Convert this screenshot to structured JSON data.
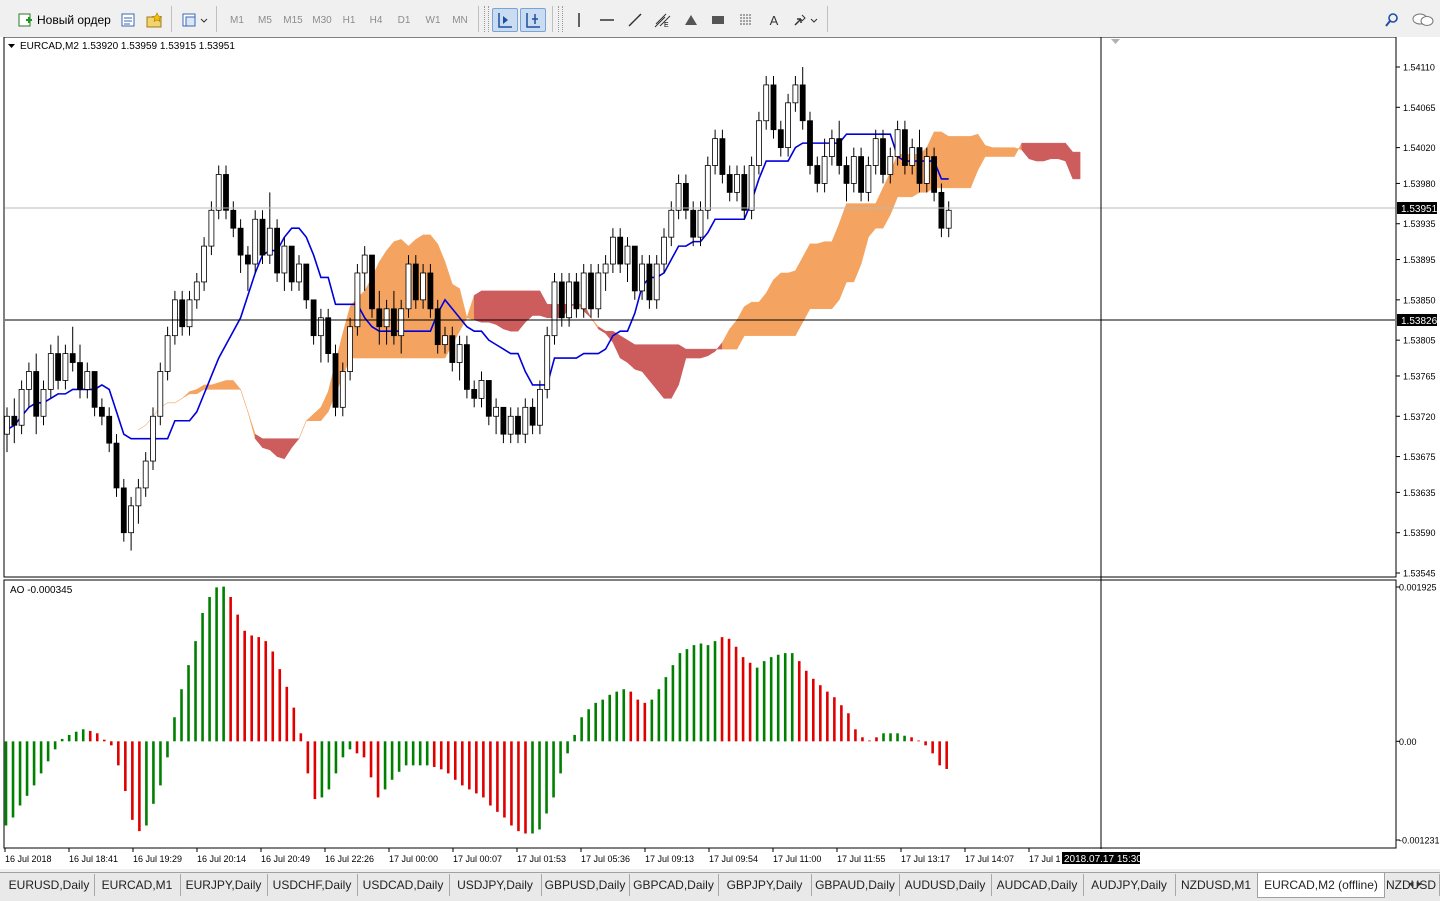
{
  "toolbar": {
    "new_order_label": "Новый ордер",
    "timeframes": [
      "M1",
      "M5",
      "M15",
      "M30",
      "H1",
      "H4",
      "D1",
      "W1",
      "MN"
    ],
    "tools": [
      "cursor-icon",
      "crosshair-icon",
      "vertical-line-icon",
      "horizontal-line-icon",
      "trendline-icon",
      "fibonacci-icon",
      "triangle-icon",
      "rectangle-icon",
      "grid-icon",
      "text-icon",
      "arrows-icon"
    ],
    "right_icons": [
      "search-icon",
      "chat-icon"
    ]
  },
  "chart_data": {
    "type": "candlestick",
    "symbol_label": "EURCAD,M2",
    "ohlc_label": "1.53920 1.53959 1.53915 1.53951",
    "price_ticks": [
      "1.54110",
      "1.54065",
      "1.54020",
      "1.53980",
      "1.53935",
      "1.53895",
      "1.53850",
      "1.53805",
      "1.53765",
      "1.53720",
      "1.53675",
      "1.53635",
      "1.53590",
      "1.53545"
    ],
    "current_price": "1.53951",
    "crosshair_price": "1.53826",
    "time_ticks": [
      "16 Jul 2018",
      "16 Jul 18:41",
      "16 Jul 19:29",
      "16 Jul 20:14",
      "16 Jul 20:49",
      "16 Jul 22:26",
      "17 Jul 00:00",
      "17 Jul 00:07",
      "17 Jul 01:53",
      "17 Jul 05:36",
      "17 Jul 09:13",
      "17 Jul 09:54",
      "17 Jul 11:00",
      "17 Jul 11:55",
      "17 Jul 13:17",
      "17 Jul 14:07",
      "17 Jul 1"
    ],
    "crosshair_time": "2018.07.17 15:30",
    "indicator_label": "AO -0.000345",
    "ao_ticks": [
      "0.001925",
      "0.00",
      "-0.001231"
    ],
    "ao_range": [
      -0.001231,
      0.001925
    ],
    "ao_values": [
      -0.00105,
      -0.00095,
      -0.0008,
      -0.00068,
      -0.00055,
      -0.0004,
      -0.00025,
      -0.0001,
      3e-05,
      8e-05,
      0.00012,
      0.00015,
      0.00013,
      0.0001,
      2e-05,
      -5e-05,
      -0.0003,
      -0.00062,
      -0.00098,
      -0.00112,
      -0.00105,
      -0.00078,
      -0.00055,
      -0.0002,
      0.0003,
      0.00065,
      0.00095,
      0.00125,
      0.0016,
      0.0018,
      0.00192,
      0.00193,
      0.0018,
      0.00158,
      0.00138,
      0.00132,
      0.0013,
      0.00125,
      0.00112,
      0.0009,
      0.00068,
      0.00042,
      0.0001,
      -0.0004,
      -0.00072,
      -0.0007,
      -0.0006,
      -0.0004,
      -0.0002,
      -0.0001,
      -0.00015,
      -0.0002,
      -0.00045,
      -0.0007,
      -0.0006,
      -0.00048,
      -0.00038,
      -0.0003,
      -0.0003,
      -0.0003,
      -0.0003,
      -0.00032,
      -0.00035,
      -0.0004,
      -0.00048,
      -0.00055,
      -0.0006,
      -0.00065,
      -0.0007,
      -0.0008,
      -0.00088,
      -0.00095,
      -0.00105,
      -0.00112,
      -0.00115,
      -0.00115,
      -0.0011,
      -0.0009,
      -0.0007,
      -0.0004,
      -0.00015,
      8e-05,
      0.0003,
      0.0004,
      0.00048,
      0.00052,
      0.00058,
      0.00062,
      0.00065,
      0.00062,
      0.00052,
      0.00048,
      0.00052,
      0.00065,
      0.0008,
      0.00095,
      0.0011,
      0.00115,
      0.0012,
      0.00122,
      0.0012,
      0.00125,
      0.0013,
      0.00128,
      0.00118,
      0.00105,
      0.00098,
      0.00092,
      0.001,
      0.00105,
      0.00108,
      0.0011,
      0.0011,
      0.001,
      0.00088,
      0.00078,
      0.0007,
      0.00062,
      0.00055,
      0.00045,
      0.00035,
      0.00015,
      5e-05,
      1e-05,
      5e-05,
      0.0001,
      0.0001,
      0.0001,
      7e-05,
      5e-05,
      1e-05,
      -5e-05,
      -0.00015,
      -0.0003,
      -0.000345
    ],
    "ao_colors": [
      "g",
      "g",
      "g",
      "g",
      "g",
      "g",
      "g",
      "g",
      "g",
      "g",
      "g",
      "g",
      "r",
      "r",
      "r",
      "r",
      "r",
      "r",
      "r",
      "r",
      "g",
      "g",
      "g",
      "g",
      "g",
      "g",
      "g",
      "g",
      "g",
      "g",
      "g",
      "g",
      "r",
      "r",
      "r",
      "r",
      "r",
      "r",
      "r",
      "r",
      "r",
      "r",
      "r",
      "r",
      "r",
      "g",
      "g",
      "g",
      "g",
      "g",
      "r",
      "r",
      "r",
      "r",
      "g",
      "g",
      "g",
      "g",
      "g",
      "g",
      "g",
      "r",
      "r",
      "r",
      "r",
      "r",
      "r",
      "r",
      "r",
      "r",
      "r",
      "r",
      "r",
      "r",
      "r",
      "g",
      "g",
      "g",
      "g",
      "g",
      "g",
      "g",
      "g",
      "g",
      "g",
      "g",
      "g",
      "g",
      "g",
      "r",
      "r",
      "r",
      "g",
      "g",
      "g",
      "g",
      "g",
      "g",
      "g",
      "g",
      "g",
      "g",
      "r",
      "r",
      "r",
      "r",
      "r",
      "g",
      "g",
      "g",
      "g",
      "g",
      "g",
      "r",
      "r",
      "r",
      "r",
      "r",
      "r",
      "r",
      "r",
      "r",
      "r",
      "r",
      "r",
      "g",
      "g",
      "g",
      "g",
      "r",
      "r",
      "r",
      "r",
      "r",
      "r",
      "r"
    ],
    "candles": [
      [
        1.537,
        1.5373,
        1.5368,
        1.5372
      ],
      [
        1.5372,
        1.5374,
        1.5369,
        1.5371
      ],
      [
        1.5371,
        1.5376,
        1.537,
        1.5375
      ],
      [
        1.5375,
        1.5378,
        1.5373,
        1.5377
      ],
      [
        1.5377,
        1.5379,
        1.537,
        1.5372
      ],
      [
        1.5372,
        1.5376,
        1.5371,
        1.5375
      ],
      [
        1.5375,
        1.538,
        1.5374,
        1.5379
      ],
      [
        1.5379,
        1.5381,
        1.5375,
        1.5376
      ],
      [
        1.5376,
        1.538,
        1.5375,
        1.5379
      ],
      [
        1.5379,
        1.5382,
        1.5377,
        1.5378
      ],
      [
        1.5378,
        1.538,
        1.5374,
        1.5375
      ],
      [
        1.5375,
        1.5378,
        1.5374,
        1.5377
      ],
      [
        1.5377,
        1.5377,
        1.5372,
        1.5373
      ],
      [
        1.5373,
        1.5374,
        1.5371,
        1.5372
      ],
      [
        1.5372,
        1.5373,
        1.5368,
        1.5369
      ],
      [
        1.5369,
        1.537,
        1.5363,
        1.5364
      ],
      [
        1.5364,
        1.5365,
        1.5358,
        1.5359
      ],
      [
        1.5359,
        1.5363,
        1.5357,
        1.5362
      ],
      [
        1.5362,
        1.5365,
        1.536,
        1.5364
      ],
      [
        1.5364,
        1.5368,
        1.5363,
        1.5367
      ],
      [
        1.5367,
        1.5373,
        1.5366,
        1.5372
      ],
      [
        1.5372,
        1.5378,
        1.5371,
        1.5377
      ],
      [
        1.5377,
        1.5382,
        1.5376,
        1.5381
      ],
      [
        1.5381,
        1.5386,
        1.538,
        1.5385
      ],
      [
        1.5385,
        1.5386,
        1.5381,
        1.5382
      ],
      [
        1.5382,
        1.5386,
        1.5381,
        1.5385
      ],
      [
        1.5385,
        1.5388,
        1.5384,
        1.5387
      ],
      [
        1.5387,
        1.5392,
        1.5386,
        1.5391
      ],
      [
        1.5391,
        1.5396,
        1.539,
        1.5395
      ],
      [
        1.5395,
        1.54,
        1.5394,
        1.5399
      ],
      [
        1.5399,
        1.54,
        1.5394,
        1.5395
      ],
      [
        1.5395,
        1.5396,
        1.5392,
        1.5393
      ],
      [
        1.5393,
        1.5394,
        1.5388,
        1.539
      ],
      [
        1.539,
        1.5391,
        1.5386,
        1.5389
      ],
      [
        1.5389,
        1.5395,
        1.5388,
        1.5394
      ],
      [
        1.5394,
        1.5395,
        1.5389,
        1.539
      ],
      [
        1.539,
        1.5397,
        1.5389,
        1.5393
      ],
      [
        1.5393,
        1.5394,
        1.5387,
        1.5388
      ],
      [
        1.5388,
        1.5392,
        1.5386,
        1.5391
      ],
      [
        1.5391,
        1.5391,
        1.5386,
        1.5387
      ],
      [
        1.5387,
        1.539,
        1.5386,
        1.5389
      ],
      [
        1.5389,
        1.5389,
        1.5384,
        1.5385
      ],
      [
        1.5385,
        1.5385,
        1.538,
        1.5381
      ],
      [
        1.5381,
        1.5384,
        1.5378,
        1.5383
      ],
      [
        1.5383,
        1.5384,
        1.5378,
        1.5379
      ],
      [
        1.5379,
        1.538,
        1.5372,
        1.5373
      ],
      [
        1.5373,
        1.5378,
        1.5372,
        1.5377
      ],
      [
        1.5377,
        1.5383,
        1.5376,
        1.5382
      ],
      [
        1.5382,
        1.5389,
        1.5381,
        1.5388
      ],
      [
        1.5388,
        1.5391,
        1.5386,
        1.539
      ],
      [
        1.539,
        1.539,
        1.5383,
        1.5384
      ],
      [
        1.5384,
        1.5386,
        1.538,
        1.5382
      ],
      [
        1.5382,
        1.5385,
        1.538,
        1.5384
      ],
      [
        1.5384,
        1.5386,
        1.538,
        1.5381
      ],
      [
        1.5381,
        1.5385,
        1.5379,
        1.5384
      ],
      [
        1.5384,
        1.539,
        1.5383,
        1.5389
      ],
      [
        1.5389,
        1.539,
        1.5384,
        1.5385
      ],
      [
        1.5385,
        1.5389,
        1.5384,
        1.5388
      ],
      [
        1.5388,
        1.5389,
        1.5383,
        1.5384
      ],
      [
        1.5384,
        1.5385,
        1.5379,
        1.538
      ],
      [
        1.538,
        1.5382,
        1.5379,
        1.5381
      ],
      [
        1.5381,
        1.5382,
        1.5377,
        1.5378
      ],
      [
        1.5378,
        1.5381,
        1.5376,
        1.538
      ],
      [
        1.538,
        1.5381,
        1.5374,
        1.5375
      ],
      [
        1.5375,
        1.5376,
        1.5373,
        1.5374
      ],
      [
        1.5374,
        1.5377,
        1.5373,
        1.5376
      ],
      [
        1.5376,
        1.5376,
        1.5371,
        1.5372
      ],
      [
        1.5372,
        1.5374,
        1.537,
        1.5373
      ],
      [
        1.5373,
        1.5373,
        1.5369,
        1.537
      ],
      [
        1.537,
        1.5373,
        1.5369,
        1.5372
      ],
      [
        1.5372,
        1.5373,
        1.5369,
        1.537
      ],
      [
        1.537,
        1.5374,
        1.5369,
        1.5373
      ],
      [
        1.5373,
        1.5374,
        1.537,
        1.5371
      ],
      [
        1.5371,
        1.5376,
        1.537,
        1.5375
      ],
      [
        1.5375,
        1.5382,
        1.5374,
        1.5381
      ],
      [
        1.5381,
        1.5388,
        1.538,
        1.5387
      ],
      [
        1.5387,
        1.5388,
        1.5382,
        1.5383
      ],
      [
        1.5383,
        1.5388,
        1.5382,
        1.5387
      ],
      [
        1.5387,
        1.5388,
        1.5383,
        1.5384
      ],
      [
        1.5384,
        1.5389,
        1.5383,
        1.5388
      ],
      [
        1.5388,
        1.5389,
        1.5383,
        1.5384
      ],
      [
        1.5384,
        1.5389,
        1.5383,
        1.5388
      ],
      [
        1.5388,
        1.539,
        1.5386,
        1.5389
      ],
      [
        1.5389,
        1.5393,
        1.5388,
        1.5392
      ],
      [
        1.5392,
        1.5393,
        1.5388,
        1.5389
      ],
      [
        1.5389,
        1.5392,
        1.5387,
        1.5391
      ],
      [
        1.5391,
        1.5391,
        1.5385,
        1.5386
      ],
      [
        1.5386,
        1.539,
        1.5385,
        1.5389
      ],
      [
        1.5389,
        1.539,
        1.5384,
        1.5385
      ],
      [
        1.5385,
        1.539,
        1.5384,
        1.5389
      ],
      [
        1.5389,
        1.5393,
        1.5388,
        1.5392
      ],
      [
        1.5392,
        1.5396,
        1.5391,
        1.5395
      ],
      [
        1.5395,
        1.5399,
        1.5394,
        1.5398
      ],
      [
        1.5398,
        1.5399,
        1.5394,
        1.5395
      ],
      [
        1.5395,
        1.5396,
        1.5391,
        1.5392
      ],
      [
        1.5392,
        1.5396,
        1.5391,
        1.5395
      ],
      [
        1.5395,
        1.5401,
        1.5394,
        1.54
      ],
      [
        1.54,
        1.5404,
        1.5399,
        1.5403
      ],
      [
        1.5403,
        1.5404,
        1.5398,
        1.5399
      ],
      [
        1.5399,
        1.54,
        1.5396,
        1.5397
      ],
      [
        1.5397,
        1.54,
        1.5396,
        1.5399
      ],
      [
        1.5399,
        1.54,
        1.5394,
        1.5395
      ],
      [
        1.5395,
        1.5401,
        1.5394,
        1.54
      ],
      [
        1.54,
        1.5406,
        1.5399,
        1.5405
      ],
      [
        1.5405,
        1.541,
        1.5404,
        1.5409
      ],
      [
        1.5409,
        1.541,
        1.5403,
        1.5404
      ],
      [
        1.5404,
        1.5405,
        1.5401,
        1.5402
      ],
      [
        1.5402,
        1.5408,
        1.5401,
        1.5407
      ],
      [
        1.5407,
        1.541,
        1.5406,
        1.5409
      ],
      [
        1.5409,
        1.5411,
        1.5404,
        1.5405
      ],
      [
        1.5405,
        1.5406,
        1.5399,
        1.54
      ],
      [
        1.54,
        1.5401,
        1.5397,
        1.5398
      ],
      [
        1.5398,
        1.5403,
        1.5397,
        1.5401
      ],
      [
        1.5401,
        1.5404,
        1.54,
        1.5403
      ],
      [
        1.5403,
        1.5405,
        1.5399,
        1.54
      ],
      [
        1.54,
        1.5401,
        1.5396,
        1.5398
      ],
      [
        1.5398,
        1.5402,
        1.5397,
        1.5401
      ],
      [
        1.5401,
        1.5402,
        1.5396,
        1.5397
      ],
      [
        1.5397,
        1.5401,
        1.5396,
        1.54
      ],
      [
        1.54,
        1.5404,
        1.5399,
        1.5403
      ],
      [
        1.5403,
        1.5404,
        1.5398,
        1.5399
      ],
      [
        1.5399,
        1.5402,
        1.5398,
        1.5401
      ],
      [
        1.5401,
        1.5405,
        1.54,
        1.5404
      ],
      [
        1.5404,
        1.5405,
        1.5399,
        1.54
      ],
      [
        1.54,
        1.5403,
        1.5399,
        1.5402
      ],
      [
        1.5402,
        1.5404,
        1.5397,
        1.5398
      ],
      [
        1.5398,
        1.5402,
        1.5397,
        1.5401
      ],
      [
        1.5401,
        1.5402,
        1.5396,
        1.5397
      ],
      [
        1.5397,
        1.5398,
        1.5392,
        1.5393
      ],
      [
        1.5393,
        1.5396,
        1.5392,
        1.5395
      ]
    ]
  },
  "tabs": [
    "EURUSD,Daily",
    "EURCAD,M1",
    "EURJPY,Daily",
    "USDCHF,Daily",
    "USDCAD,Daily",
    "USDJPY,Daily",
    "GBPUSD,Daily",
    "GBPCAD,Daily",
    "GBPJPY,Daily",
    "GBPAUD,Daily",
    "AUDUSD,Daily",
    "AUDCAD,Daily",
    "AUDJPY,Daily",
    "NZDUSD,M1",
    "EURCAD,M2 (offline)",
    "NZDUSD"
  ],
  "active_tab": "EURCAD,M2 (offline)",
  "colors": {
    "bull_ao": "#008000",
    "bear_ao": "#e00000",
    "cloud_up": "#f4a460",
    "cloud_down": "#cd5c5c",
    "kijun": "#0000dd",
    "candle": "#000000"
  }
}
